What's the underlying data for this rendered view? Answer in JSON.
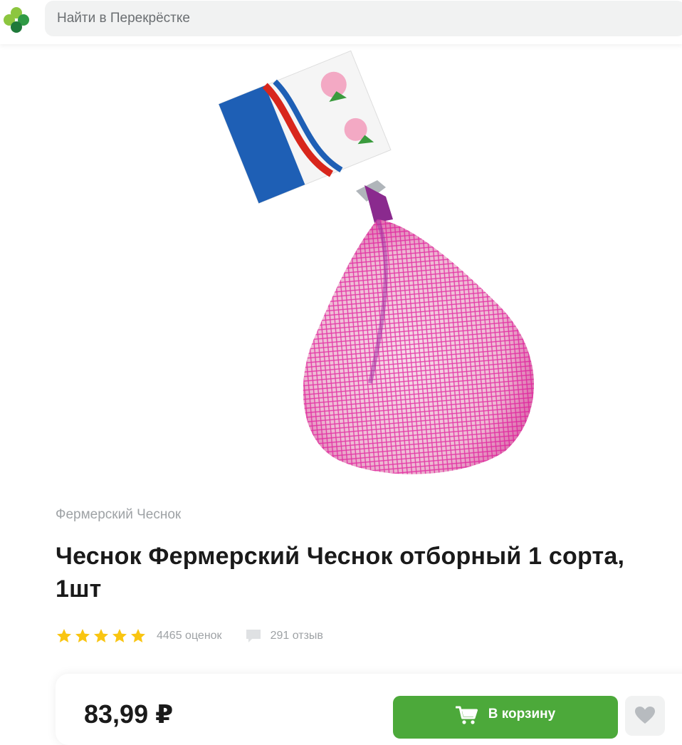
{
  "header": {
    "logo_icon": "perekrestok-clover-logo",
    "search": {
      "placeholder": "Найти в Перекрёстке"
    }
  },
  "product": {
    "image_description_icon": "garlic-in-pink-mesh-bag-image",
    "brand": "Фермерский Чеснок",
    "title": "Чеснок Фермерский Чеснок отборный 1 сорта, 1шт",
    "rating": {
      "stars_filled": 5,
      "stars_total": 5,
      "count_label": "4465 оценок"
    },
    "reviews": {
      "icon": "speech-bubble-icon",
      "count_label": "291 отзыв"
    },
    "purchase": {
      "price": "83,99 ₽",
      "cart_button_label": "В корзину",
      "cart_icon": "shopping-cart-icon",
      "favorite_icon": "heart-icon"
    }
  },
  "colors": {
    "accent_green": "#4ca93a",
    "star_yellow": "#f9c511",
    "muted_text": "#9ea2a5",
    "search_bg": "#f1f2f2"
  }
}
